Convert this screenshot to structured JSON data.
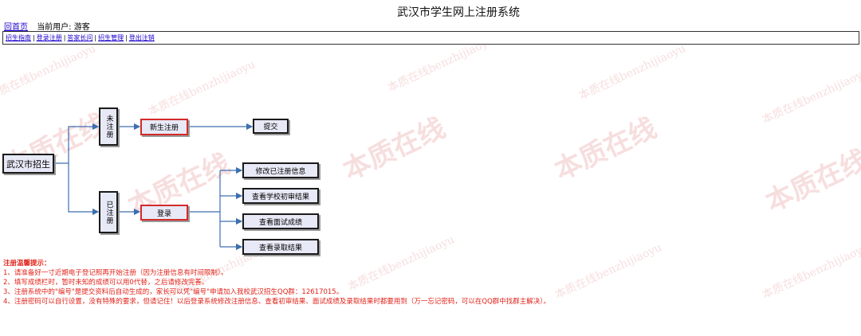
{
  "header": {
    "title": "武汉市学生网上注册系统"
  },
  "topbar": {
    "home_link": "回首页",
    "current_user": "当前用户: 游客"
  },
  "nav": {
    "items": [
      {
        "label": "招生指南"
      },
      {
        "label": "登录注册"
      },
      {
        "label": "答家长问"
      },
      {
        "label": "招生管理"
      },
      {
        "label": "登出注销"
      }
    ]
  },
  "flowchart": {
    "root": "武汉市招生",
    "not_registered": "未注册",
    "registered": "已注册",
    "new_registration": "新生注册",
    "submit": "提交",
    "login": "登录",
    "actions": [
      "修改已注册信息",
      "查看学校初审结果",
      "查看面试成绩",
      "查看录取结果"
    ]
  },
  "notes": {
    "heading": "注册温馨提示：",
    "lines": [
      "1、请准备好一寸近期电子登记照再开始注册（因为注册信息有时间限制）。",
      "2、填写成绩栏时，暂时未知的成绩可以用0代替，之后请修改完善。",
      "3、注册系统中的\"编号\"是提交资料后自动生成的，家长可以凭\"编号\"申请加入我校武汉招生QQ群：12617015。",
      "4、注册密码可以自行设置，没有特殊的要求，但请记住！以后登录系统修改注册信息、查看初审结果、面试成绩及录取结果时都要用到（万一忘记密码，可以在QQ群中找群主解决）。"
    ]
  },
  "watermark": {
    "big": "本质在线",
    "small": "本质在线benzhijiaoyu"
  },
  "colors": {
    "link": "#1a00cc",
    "notes": "#e2231a",
    "box_fill": "#e7e9f6",
    "line": "#3d6fb0",
    "highlight_border": "#d42a2a"
  }
}
